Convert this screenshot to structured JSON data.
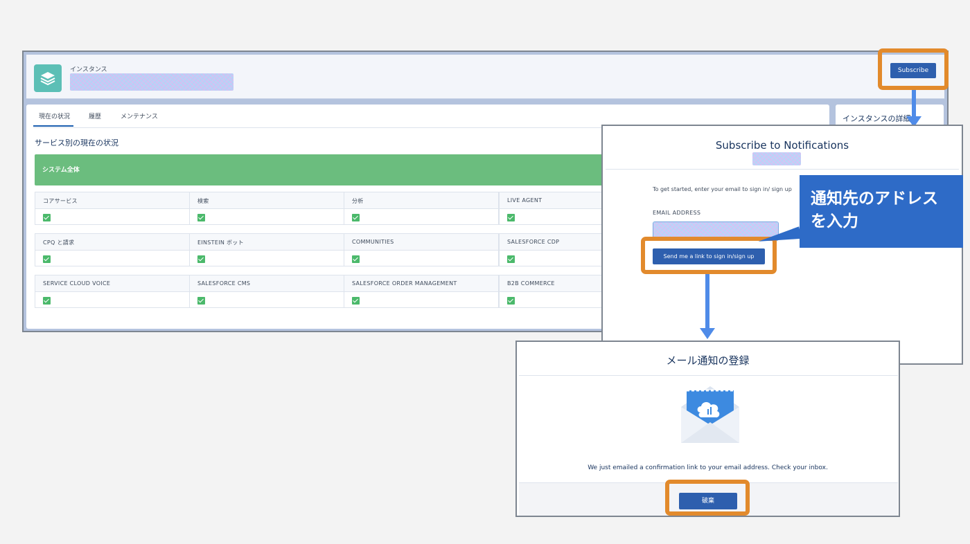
{
  "instance": {
    "label": "インスタンス",
    "subscribe_label": "Subscribe",
    "details_title": "インスタンスの詳細"
  },
  "tabs": [
    {
      "label": "現在の状況"
    },
    {
      "label": "履歴"
    },
    {
      "label": "メンテナンス"
    }
  ],
  "status": {
    "section_title": "サービス別の現在の状況",
    "system_label": "システム全体",
    "rows": [
      [
        "コアサービス",
        "検索",
        "分析",
        "LIVE AGENT"
      ],
      [
        "CPQ と請求",
        "EINSTEIN ボット",
        "COMMUNITIES",
        "SALESFORCE CDP"
      ],
      [
        "SERVICE CLOUD VOICE",
        "SALESFORCE CMS",
        "SALESFORCE ORDER MANAGEMENT",
        "B2B COMMERCE"
      ]
    ]
  },
  "subscribe_dialog": {
    "title": "Subscribe to Notifications",
    "intro": "To get started, enter your email to sign in/ sign up",
    "email_label": "EMAIL ADDRESS",
    "send_label": "Send me a link to sign in/sign up"
  },
  "callout": {
    "line1": "通知先のアドレス",
    "line2": "を入力"
  },
  "confirm_dialog": {
    "title": "メール通知の登録",
    "message": "We just emailed a confirmation link to your email address. Check your inbox.",
    "discard_label": "破棄"
  },
  "colors": {
    "highlight": "#e28a2c",
    "arrow": "#4f8be8",
    "button": "#2e5fae",
    "operational_green": "#6bbd7e",
    "callout_bg": "#2e6bc7"
  }
}
